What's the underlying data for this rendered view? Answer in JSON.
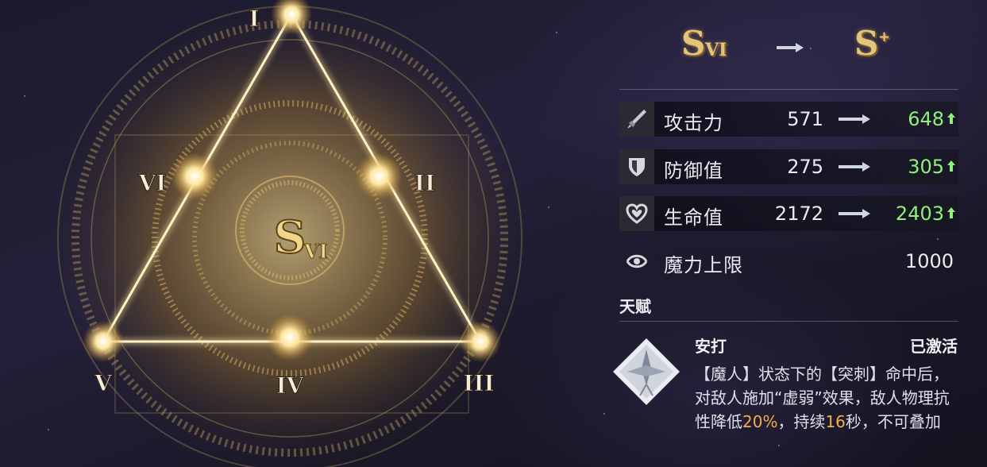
{
  "sigil": {
    "center_rank": "S",
    "center_rank_suffix": "VI",
    "nodes": [
      "I",
      "II",
      "III",
      "IV",
      "V",
      "VI"
    ]
  },
  "rank_change": {
    "from": "S",
    "from_suffix": "VI",
    "to": "S",
    "to_suffix": "+"
  },
  "stats": [
    {
      "label": "攻击力",
      "current": "571",
      "new": "648",
      "icon": "sword-icon"
    },
    {
      "label": "防御值",
      "current": "275",
      "new": "305",
      "icon": "shield-icon"
    },
    {
      "label": "生命值",
      "current": "2172",
      "new": "2403",
      "icon": "heart-icon"
    },
    {
      "label": "魔力上限",
      "value": "1000",
      "icon": "mana-swirl-icon"
    }
  ],
  "talent_section": {
    "title": "天赋",
    "name": "安打",
    "status": "已激活",
    "desc_parts": [
      "【魔人】状态下的【突刺】命中后，对敌人施加“虚弱”效果，敌人物理抗性降低",
      "20%",
      "，持续",
      "16",
      "秒，不可叠加"
    ]
  },
  "colors": {
    "gold": "#e3c57a",
    "increase": "#8ff07a",
    "highlight": "#f0b04a"
  }
}
